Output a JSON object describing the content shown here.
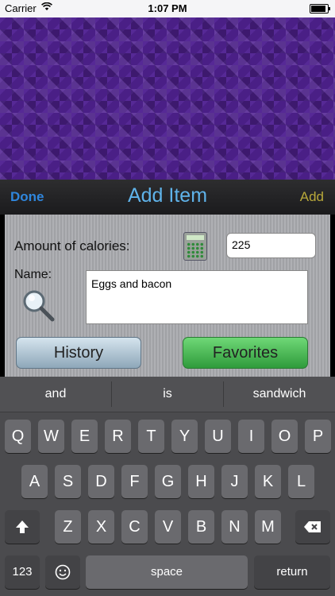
{
  "status": {
    "carrier": "Carrier",
    "time": "1:07 PM"
  },
  "nav": {
    "done": "Done",
    "title": "Add Item",
    "add": "Add"
  },
  "form": {
    "calories_label": "Amount of calories:",
    "calories_value": "225",
    "name_label": "Name:",
    "name_value": "Eggs and bacon",
    "history_button": "History",
    "favorites_button": "Favorites"
  },
  "keyboard": {
    "suggestions": [
      "and",
      "is",
      "sandwich"
    ],
    "row1": [
      "Q",
      "W",
      "E",
      "R",
      "T",
      "Y",
      "U",
      "I",
      "O",
      "P"
    ],
    "row2": [
      "A",
      "S",
      "D",
      "F",
      "G",
      "H",
      "J",
      "K",
      "L"
    ],
    "row3": [
      "Z",
      "X",
      "C",
      "V",
      "B",
      "N",
      "M"
    ],
    "numbers_key": "123",
    "space_key": "space",
    "return_key": "return",
    "shift_icon": "shift-icon",
    "delete_icon": "delete-icon",
    "emoji_icon": "emoji-icon"
  },
  "colors": {
    "accent_blue": "#2f86dc",
    "title_blue": "#5fb3ea",
    "add_gold": "#b8a83a",
    "favorites_green": "#3faa48"
  }
}
